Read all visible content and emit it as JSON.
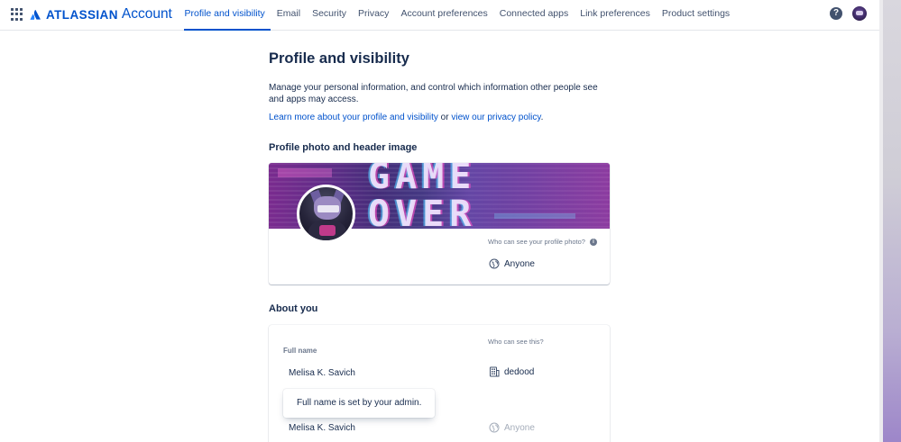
{
  "header": {
    "brand_primary": "ATLASSIAN",
    "brand_secondary": "Account",
    "nav": [
      {
        "label": "Profile and visibility",
        "active": true
      },
      {
        "label": "Email"
      },
      {
        "label": "Security"
      },
      {
        "label": "Privacy"
      },
      {
        "label": "Account preferences"
      },
      {
        "label": "Connected apps"
      },
      {
        "label": "Link preferences"
      },
      {
        "label": "Product settings"
      }
    ],
    "help_symbol": "?"
  },
  "page": {
    "title": "Profile and visibility",
    "intro": "Manage your personal information, and control which information other people see and apps may access.",
    "learn_more_link": "Learn more about your profile and visibility",
    "or_text": " or ",
    "privacy_link": "view our privacy policy",
    "period": "."
  },
  "photo_section": {
    "heading": "Profile photo and header image",
    "header_image_text": "GAME OVER",
    "who_can_see_label": "Who can see your profile photo?",
    "info_symbol": "i",
    "visibility": "Anyone",
    "visibility_icon": "globe-icon"
  },
  "about_section": {
    "heading": "About you",
    "who_can_see_label": "Who can see this?",
    "full_name_label": "Full name",
    "full_name_value": "Melisa K. Savich",
    "full_name_visibility": "dedood",
    "full_name_visibility_icon": "building-icon",
    "tooltip": "Full name is set by your admin.",
    "public_name_value": "Melisa K. Savich",
    "public_name_visibility": "Anyone",
    "public_name_visibility_icon": "globe-icon"
  },
  "colors": {
    "accent": "#0052cc",
    "text": "#172b4d",
    "subtle": "#6b778c",
    "disabled": "#a5adba"
  }
}
